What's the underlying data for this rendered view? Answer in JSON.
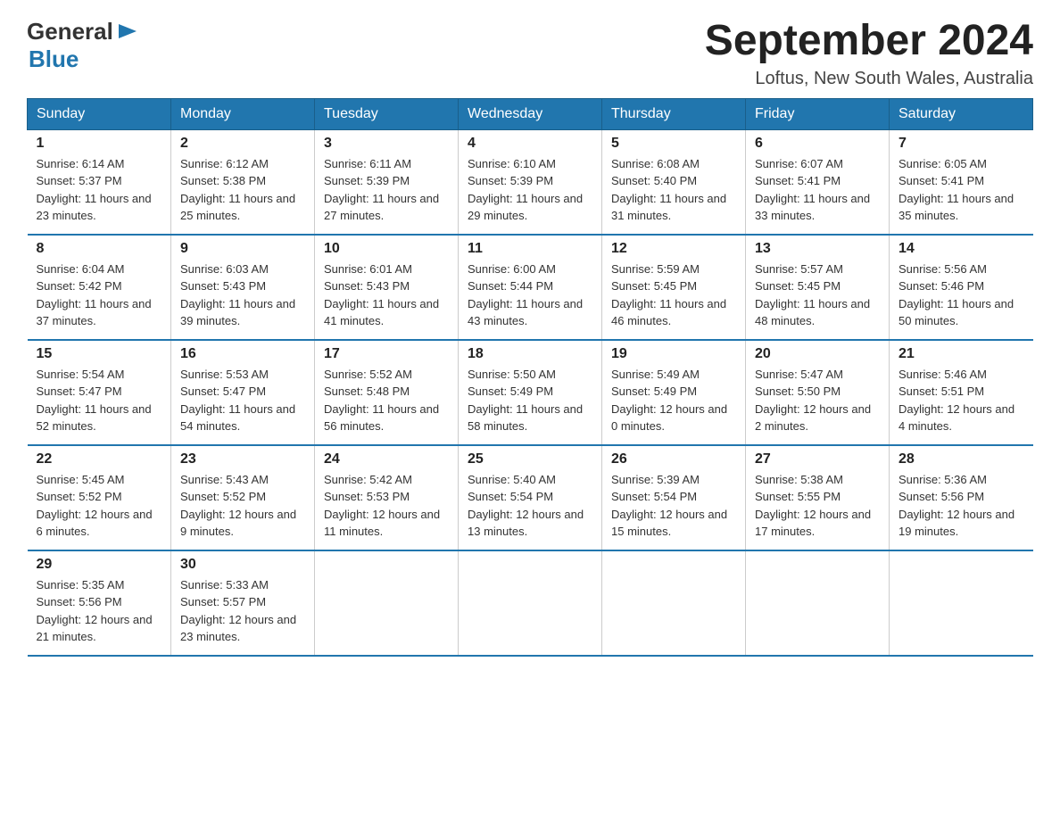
{
  "header": {
    "logo_general": "General",
    "logo_blue": "Blue",
    "month_title": "September 2024",
    "location": "Loftus, New South Wales, Australia"
  },
  "weekdays": [
    "Sunday",
    "Monday",
    "Tuesday",
    "Wednesday",
    "Thursday",
    "Friday",
    "Saturday"
  ],
  "weeks": [
    [
      {
        "day": "1",
        "sunrise": "6:14 AM",
        "sunset": "5:37 PM",
        "daylight": "11 hours and 23 minutes."
      },
      {
        "day": "2",
        "sunrise": "6:12 AM",
        "sunset": "5:38 PM",
        "daylight": "11 hours and 25 minutes."
      },
      {
        "day": "3",
        "sunrise": "6:11 AM",
        "sunset": "5:39 PM",
        "daylight": "11 hours and 27 minutes."
      },
      {
        "day": "4",
        "sunrise": "6:10 AM",
        "sunset": "5:39 PM",
        "daylight": "11 hours and 29 minutes."
      },
      {
        "day": "5",
        "sunrise": "6:08 AM",
        "sunset": "5:40 PM",
        "daylight": "11 hours and 31 minutes."
      },
      {
        "day": "6",
        "sunrise": "6:07 AM",
        "sunset": "5:41 PM",
        "daylight": "11 hours and 33 minutes."
      },
      {
        "day": "7",
        "sunrise": "6:05 AM",
        "sunset": "5:41 PM",
        "daylight": "11 hours and 35 minutes."
      }
    ],
    [
      {
        "day": "8",
        "sunrise": "6:04 AM",
        "sunset": "5:42 PM",
        "daylight": "11 hours and 37 minutes."
      },
      {
        "day": "9",
        "sunrise": "6:03 AM",
        "sunset": "5:43 PM",
        "daylight": "11 hours and 39 minutes."
      },
      {
        "day": "10",
        "sunrise": "6:01 AM",
        "sunset": "5:43 PM",
        "daylight": "11 hours and 41 minutes."
      },
      {
        "day": "11",
        "sunrise": "6:00 AM",
        "sunset": "5:44 PM",
        "daylight": "11 hours and 43 minutes."
      },
      {
        "day": "12",
        "sunrise": "5:59 AM",
        "sunset": "5:45 PM",
        "daylight": "11 hours and 46 minutes."
      },
      {
        "day": "13",
        "sunrise": "5:57 AM",
        "sunset": "5:45 PM",
        "daylight": "11 hours and 48 minutes."
      },
      {
        "day": "14",
        "sunrise": "5:56 AM",
        "sunset": "5:46 PM",
        "daylight": "11 hours and 50 minutes."
      }
    ],
    [
      {
        "day": "15",
        "sunrise": "5:54 AM",
        "sunset": "5:47 PM",
        "daylight": "11 hours and 52 minutes."
      },
      {
        "day": "16",
        "sunrise": "5:53 AM",
        "sunset": "5:47 PM",
        "daylight": "11 hours and 54 minutes."
      },
      {
        "day": "17",
        "sunrise": "5:52 AM",
        "sunset": "5:48 PM",
        "daylight": "11 hours and 56 minutes."
      },
      {
        "day": "18",
        "sunrise": "5:50 AM",
        "sunset": "5:49 PM",
        "daylight": "11 hours and 58 minutes."
      },
      {
        "day": "19",
        "sunrise": "5:49 AM",
        "sunset": "5:49 PM",
        "daylight": "12 hours and 0 minutes."
      },
      {
        "day": "20",
        "sunrise": "5:47 AM",
        "sunset": "5:50 PM",
        "daylight": "12 hours and 2 minutes."
      },
      {
        "day": "21",
        "sunrise": "5:46 AM",
        "sunset": "5:51 PM",
        "daylight": "12 hours and 4 minutes."
      }
    ],
    [
      {
        "day": "22",
        "sunrise": "5:45 AM",
        "sunset": "5:52 PM",
        "daylight": "12 hours and 6 minutes."
      },
      {
        "day": "23",
        "sunrise": "5:43 AM",
        "sunset": "5:52 PM",
        "daylight": "12 hours and 9 minutes."
      },
      {
        "day": "24",
        "sunrise": "5:42 AM",
        "sunset": "5:53 PM",
        "daylight": "12 hours and 11 minutes."
      },
      {
        "day": "25",
        "sunrise": "5:40 AM",
        "sunset": "5:54 PM",
        "daylight": "12 hours and 13 minutes."
      },
      {
        "day": "26",
        "sunrise": "5:39 AM",
        "sunset": "5:54 PM",
        "daylight": "12 hours and 15 minutes."
      },
      {
        "day": "27",
        "sunrise": "5:38 AM",
        "sunset": "5:55 PM",
        "daylight": "12 hours and 17 minutes."
      },
      {
        "day": "28",
        "sunrise": "5:36 AM",
        "sunset": "5:56 PM",
        "daylight": "12 hours and 19 minutes."
      }
    ],
    [
      {
        "day": "29",
        "sunrise": "5:35 AM",
        "sunset": "5:56 PM",
        "daylight": "12 hours and 21 minutes."
      },
      {
        "day": "30",
        "sunrise": "5:33 AM",
        "sunset": "5:57 PM",
        "daylight": "12 hours and 23 minutes."
      },
      null,
      null,
      null,
      null,
      null
    ]
  ],
  "labels": {
    "sunrise": "Sunrise:",
    "sunset": "Sunset:",
    "daylight": "Daylight:"
  }
}
